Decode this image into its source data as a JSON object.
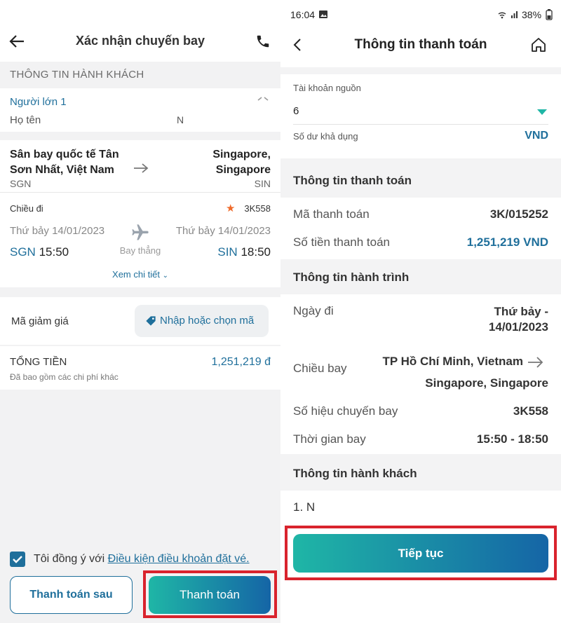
{
  "left": {
    "header": {
      "title": "Xác nhận chuyến bay"
    },
    "passenger": {
      "section_title": "THÔNG TIN HÀNH KHÁCH",
      "adult_label": "Người lớn 1",
      "name_label": "Họ tên",
      "name_value": "N"
    },
    "route": {
      "from_name_line1": "Sân bay quốc tế Tân",
      "from_name_line2": "Sơn Nhất, Việt Nam",
      "from_code": "SGN",
      "to_name_line1": "Singapore,",
      "to_name_line2": "Singapore",
      "to_code": "SIN"
    },
    "leg": {
      "direction_label": "Chiều đi",
      "flight_no": "3K558",
      "depart_date": "Thứ bảy 14/01/2023",
      "arrive_date": "Thứ bảy 14/01/2023",
      "depart_code": "SGN",
      "depart_time": "15:50",
      "arrive_code": "SIN",
      "arrive_time": "18:50",
      "stop_label": "Bay thẳng",
      "details_link": "Xem chi tiết"
    },
    "discount": {
      "label": "Mã giảm giá",
      "button_label": "Nhập hoặc chọn mã"
    },
    "total": {
      "label": "TỔNG TIỀN",
      "note": "Đã bao gồm các chi phí khác",
      "amount": "1,251,219 đ"
    },
    "agree": {
      "prefix": "Tôi đồng ý với ",
      "link": "Điều kiện điều khoản đặt vé."
    },
    "buttons": {
      "later": "Thanh toán sau",
      "pay": "Thanh toán"
    }
  },
  "right": {
    "status": {
      "time": "16:04",
      "battery": "38%"
    },
    "header": {
      "title": "Thông tin thanh toán"
    },
    "source": {
      "label": "Tài khoản nguồn",
      "value": "6",
      "balance_label": "Số dư khả dụng",
      "currency": "VND"
    },
    "payment": {
      "section_title": "Thông tin thanh toán",
      "code_label": "Mã thanh toán",
      "code_value": "3K/015252",
      "amount_label": "Số tiền thanh toán",
      "amount_value": "1,251,219 VND"
    },
    "itinerary": {
      "section_title": "Thông tin hành trình",
      "date_label": "Ngày đi",
      "date_line1": "Thứ bảy -",
      "date_line2": "14/01/2023",
      "direction_label": "Chiều bay",
      "from_city": "TP Hồ Chí Minh, Vietnam",
      "to_city": "Singapore, Singapore",
      "flight_label": "Số hiệu chuyến bay",
      "flight_value": "3K558",
      "time_label": "Thời gian bay",
      "time_value": "15:50 - 18:50"
    },
    "passenger": {
      "section_title": "Thông tin hành khách",
      "first": "1. N"
    },
    "continue_label": "Tiếp tục"
  },
  "colors": {
    "accent_blue": "#1f6f9b",
    "teal": "#1fb6a6",
    "highlight_red": "#d9232d",
    "star_orange": "#ef6a2a"
  }
}
